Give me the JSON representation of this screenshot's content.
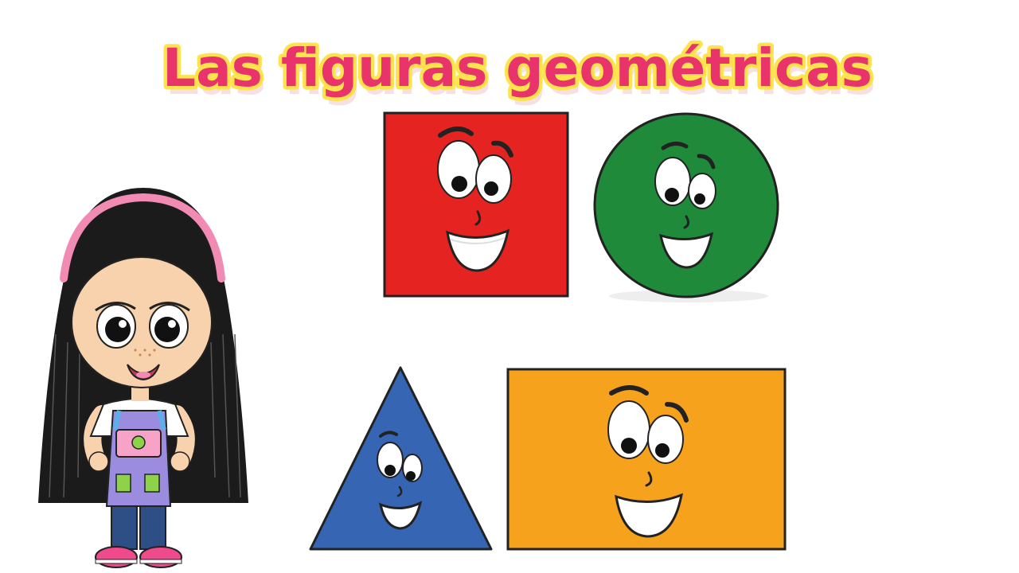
{
  "title": "Las figuras geométricas",
  "colors": {
    "title_fill": "#e8336b",
    "title_outline": "#ffe34d",
    "square": "#e52421",
    "circle": "#1f8a3a",
    "triangle": "#3565b3",
    "rectangle": "#f6a21d",
    "hair": "#1b1b1b",
    "headband": "#f28bb4",
    "skin": "#f7d2ac",
    "overalls": "#9b8ce0",
    "jeans": "#2e4f86",
    "shoes": "#ee4a8c"
  },
  "shapes": [
    {
      "name": "square",
      "icon": "smiling-square"
    },
    {
      "name": "circle",
      "icon": "smiling-circle"
    },
    {
      "name": "triangle",
      "icon": "smiling-triangle"
    },
    {
      "name": "rectangle",
      "icon": "smiling-rectangle"
    }
  ],
  "character": {
    "icon": "girl-character"
  }
}
